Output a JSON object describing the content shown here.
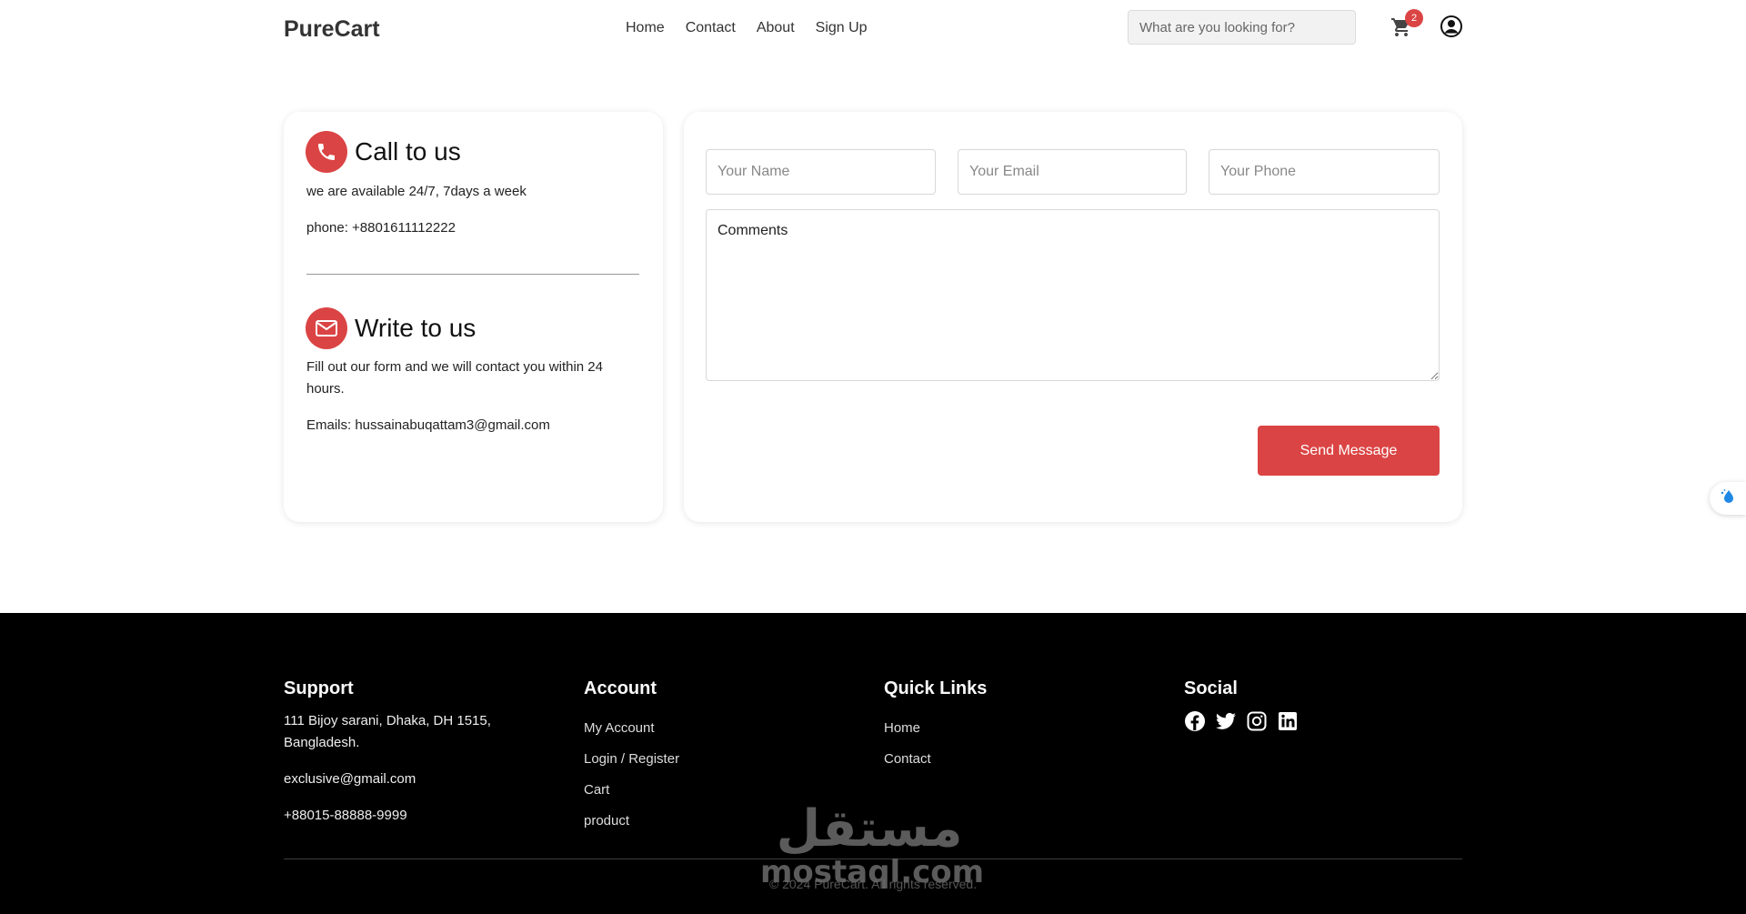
{
  "header": {
    "logo": "PureCart",
    "nav": [
      "Home",
      "Contact",
      "About",
      "Sign Up"
    ],
    "search_placeholder": "What are you looking for?",
    "cart_count": "2",
    "accent_color": "#db4444"
  },
  "contact_info": {
    "call": {
      "title": "Call to us",
      "availability": "we are available 24/7, 7days a week",
      "phone": "phone: +8801611112222",
      "icon": "phone-icon"
    },
    "write": {
      "title": "Write to us",
      "description": "Fill out our form and we will contact you within 24 hours.",
      "emails": "Emails: hussainabuqattam3@gmail.com",
      "icon": "mail-icon"
    }
  },
  "form": {
    "name_placeholder": "Your Name",
    "email_placeholder": "Your Email",
    "phone_placeholder": "Your Phone",
    "comments_placeholder": "Comments",
    "submit_label": "Send Message"
  },
  "footer": {
    "support": {
      "title": "Support",
      "address": "111 Bijoy sarani, Dhaka, DH 1515, Bangladesh.",
      "email": "exclusive@gmail.com",
      "phone": "+88015-88888-9999"
    },
    "account": {
      "title": "Account",
      "links": [
        "My Account",
        "Login / Register",
        "Cart",
        "product"
      ]
    },
    "quick_links": {
      "title": "Quick Links",
      "links": [
        "Home",
        "Contact"
      ]
    },
    "social": {
      "title": "Social",
      "icons": [
        "facebook-icon",
        "twitter-icon",
        "instagram-icon",
        "linkedin-icon"
      ]
    },
    "copyright": "© 2024 PureCart. All rights reserved.",
    "watermark_arabic": "مستقل",
    "watermark_latin": "mostaql.com"
  }
}
